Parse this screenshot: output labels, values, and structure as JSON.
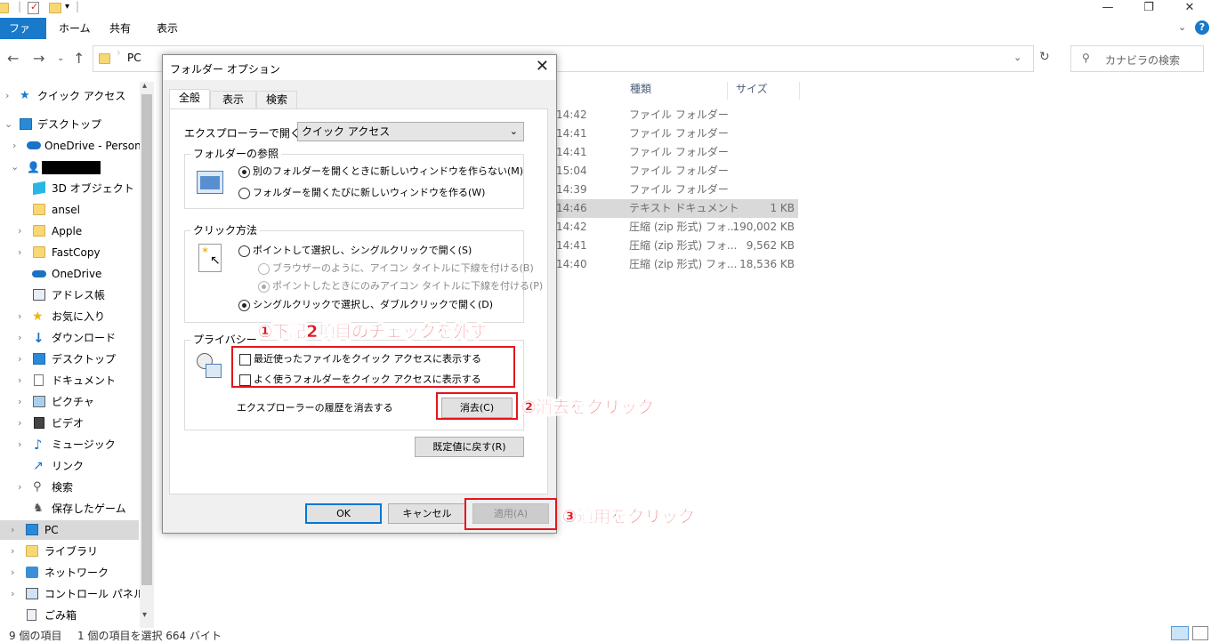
{
  "ribbon": {
    "tabs": [
      "ファイル",
      "ホーム",
      "共有",
      "表示"
    ]
  },
  "address": {
    "path": "PC",
    "search_placeholder": "カナビラの検索"
  },
  "nav": {
    "items": [
      {
        "label": "クイック アクセス"
      },
      {
        "label": "デスクトップ"
      },
      {
        "label": "OneDrive - Personal"
      },
      {
        "label": ""
      },
      {
        "label": "3D オブジェクト"
      },
      {
        "label": "ansel"
      },
      {
        "label": "Apple"
      },
      {
        "label": "FastCopy"
      },
      {
        "label": "OneDrive"
      },
      {
        "label": "アドレス帳"
      },
      {
        "label": "お気に入り"
      },
      {
        "label": "ダウンロード"
      },
      {
        "label": "デスクトップ"
      },
      {
        "label": "ドキュメント"
      },
      {
        "label": "ピクチャ"
      },
      {
        "label": "ビデオ"
      },
      {
        "label": "ミュージック"
      },
      {
        "label": "リンク"
      },
      {
        "label": "検索"
      },
      {
        "label": "保存したゲーム"
      },
      {
        "label": "PC"
      },
      {
        "label": "ライブラリ"
      },
      {
        "label": "ネットワーク"
      },
      {
        "label": "コントロール パネル"
      },
      {
        "label": "ごみ箱"
      }
    ]
  },
  "files": {
    "columns": [
      "種類",
      "サイズ"
    ],
    "rows": [
      {
        "time": "14:42",
        "type": "ファイル フォルダー",
        "size": ""
      },
      {
        "time": "14:41",
        "type": "ファイル フォルダー",
        "size": ""
      },
      {
        "time": "14:41",
        "type": "ファイル フォルダー",
        "size": ""
      },
      {
        "time": "15:04",
        "type": "ファイル フォルダー",
        "size": ""
      },
      {
        "time": "14:39",
        "type": "ファイル フォルダー",
        "size": ""
      },
      {
        "time": "14:46",
        "type": "テキスト ドキュメント",
        "size": "1 KB"
      },
      {
        "time": "14:42",
        "type": "圧縮 (zip 形式) フォ...",
        "size": "190,002 KB"
      },
      {
        "time": "14:41",
        "type": "圧縮 (zip 形式) フォ...",
        "size": "9,562 KB"
      },
      {
        "time": "14:40",
        "type": "圧縮 (zip 形式) フォ...",
        "size": "18,536 KB"
      }
    ]
  },
  "status": {
    "count": "9 個の項目",
    "selected": "1 個の項目を選択  664 バイト"
  },
  "dialog": {
    "title": "フォルダー オプション",
    "tabs": [
      "全般",
      "表示",
      "検索"
    ],
    "open_label": "エクスプローラーで開く:",
    "open_value": "クイック アクセス",
    "browse": {
      "title": "フォルダーの参照",
      "opt1": "別のフォルダーを開くときに新しいウィンドウを作らない(M)",
      "opt2": "フォルダーを開くたびに新しいウィンドウを作る(W)"
    },
    "click": {
      "title": "クリック方法",
      "opt1": "ポイントして選択し、シングルクリックで開く(S)",
      "sub1": "ブラウザーのように、アイコン タイトルに下線を付ける(B)",
      "sub2": "ポイントしたときにのみアイコン タイトルに下線を付ける(P)",
      "opt2": "シングルクリックで選択し、ダブルクリックで開く(D)"
    },
    "privacy": {
      "title": "プライバシー",
      "chk1": "最近使ったファイルをクイック アクセスに表示する",
      "chk2": "よく使うフォルダーをクイック アクセスに表示する",
      "clear_label": "エクスプローラーの履歴を消去する",
      "clear_button": "消去(C)"
    },
    "restore_button": "既定値に戻す(R)",
    "ok": "OK",
    "cancel": "キャンセル",
    "apply": "適用(A)"
  },
  "annotations": {
    "a1": "①下記2項目のチェックを外す",
    "a2": "②消去をクリック",
    "a3": "③適用をクリック"
  },
  "colors": {
    "accent": "#1979ca",
    "annotation": "#e3161d"
  }
}
